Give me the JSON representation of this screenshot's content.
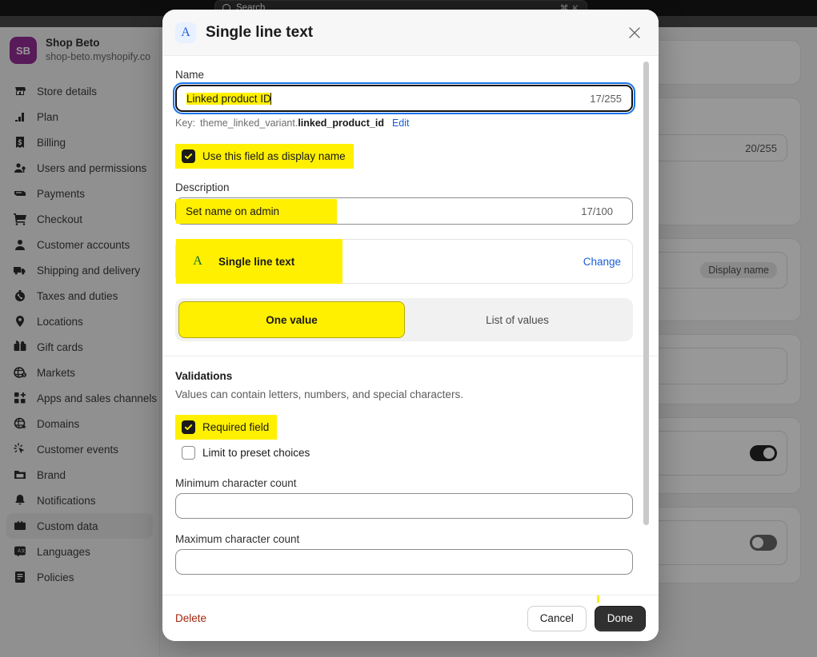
{
  "topbar": {
    "search_placeholder": "Search",
    "shortcut": "⌘ K",
    "search_icon": "search-icon"
  },
  "sidebar": {
    "shop": {
      "initials": "SB",
      "name": "Shop Beto",
      "url": "shop-beto.myshopify.co"
    },
    "items": [
      {
        "label": "Store details",
        "icon": "store-icon",
        "active": false
      },
      {
        "label": "Plan",
        "icon": "plan-icon",
        "active": false
      },
      {
        "label": "Billing",
        "icon": "billing-icon",
        "active": false
      },
      {
        "label": "Users and permissions",
        "icon": "users-icon",
        "active": false
      },
      {
        "label": "Payments",
        "icon": "payments-icon",
        "active": false
      },
      {
        "label": "Checkout",
        "icon": "cart-icon",
        "active": false
      },
      {
        "label": "Customer accounts",
        "icon": "person-icon",
        "active": false
      },
      {
        "label": "Shipping and delivery",
        "icon": "truck-icon",
        "active": false
      },
      {
        "label": "Taxes and duties",
        "icon": "taxes-icon",
        "active": false
      },
      {
        "label": "Locations",
        "icon": "pin-icon",
        "active": false
      },
      {
        "label": "Gift cards",
        "icon": "giftcard-icon",
        "active": false
      },
      {
        "label": "Markets",
        "icon": "globe-dollar-icon",
        "active": false
      },
      {
        "label": "Apps and sales channels",
        "icon": "apps-icon",
        "active": false
      },
      {
        "label": "Domains",
        "icon": "domain-icon",
        "active": false
      },
      {
        "label": "Customer events",
        "icon": "events-icon",
        "active": false
      },
      {
        "label": "Brand",
        "icon": "brand-icon",
        "active": false
      },
      {
        "label": "Notifications",
        "icon": "bell-icon",
        "active": false
      },
      {
        "label": "Custom data",
        "icon": "customdata-icon",
        "active": true
      },
      {
        "label": "Languages",
        "icon": "languages-icon",
        "active": false
      },
      {
        "label": "Policies",
        "icon": "policies-icon",
        "active": false
      }
    ]
  },
  "background_content": {
    "name_count": "20/255",
    "display_name_badge": "Display name",
    "toggle_on": "on",
    "toggle_off": "off"
  },
  "modal": {
    "icon": "single-line-text-icon",
    "icon_letter": "A",
    "title": "Single line text",
    "close_icon": "close-icon",
    "name": {
      "label": "Name",
      "value": "Linked product ID",
      "count": "17/255"
    },
    "key": {
      "label": "Key:",
      "namespace": "theme_linked_variant.",
      "key_name": "linked_product_id",
      "edit_label": "Edit"
    },
    "display_name_checkbox": {
      "label": "Use this field as display name",
      "checked": true
    },
    "description": {
      "label": "Description",
      "value": "Set name on admin",
      "count": "17/100"
    },
    "type_card": {
      "icon_letter": "A",
      "name": "Single line text",
      "change_label": "Change"
    },
    "value_mode": {
      "options": [
        "One value",
        "List of values"
      ],
      "selected": "One value"
    },
    "validations": {
      "title": "Validations",
      "description": "Values can contain letters, numbers, and special characters.",
      "required_field": {
        "label": "Required field",
        "checked": true
      },
      "limit_preset": {
        "label": "Limit to preset choices",
        "checked": false
      },
      "min_count": {
        "label": "Minimum character count",
        "value": ""
      },
      "max_count": {
        "label": "Maximum character count",
        "value": ""
      }
    },
    "footer": {
      "delete_label": "Delete",
      "cancel_label": "Cancel",
      "done_label": "Done"
    }
  }
}
